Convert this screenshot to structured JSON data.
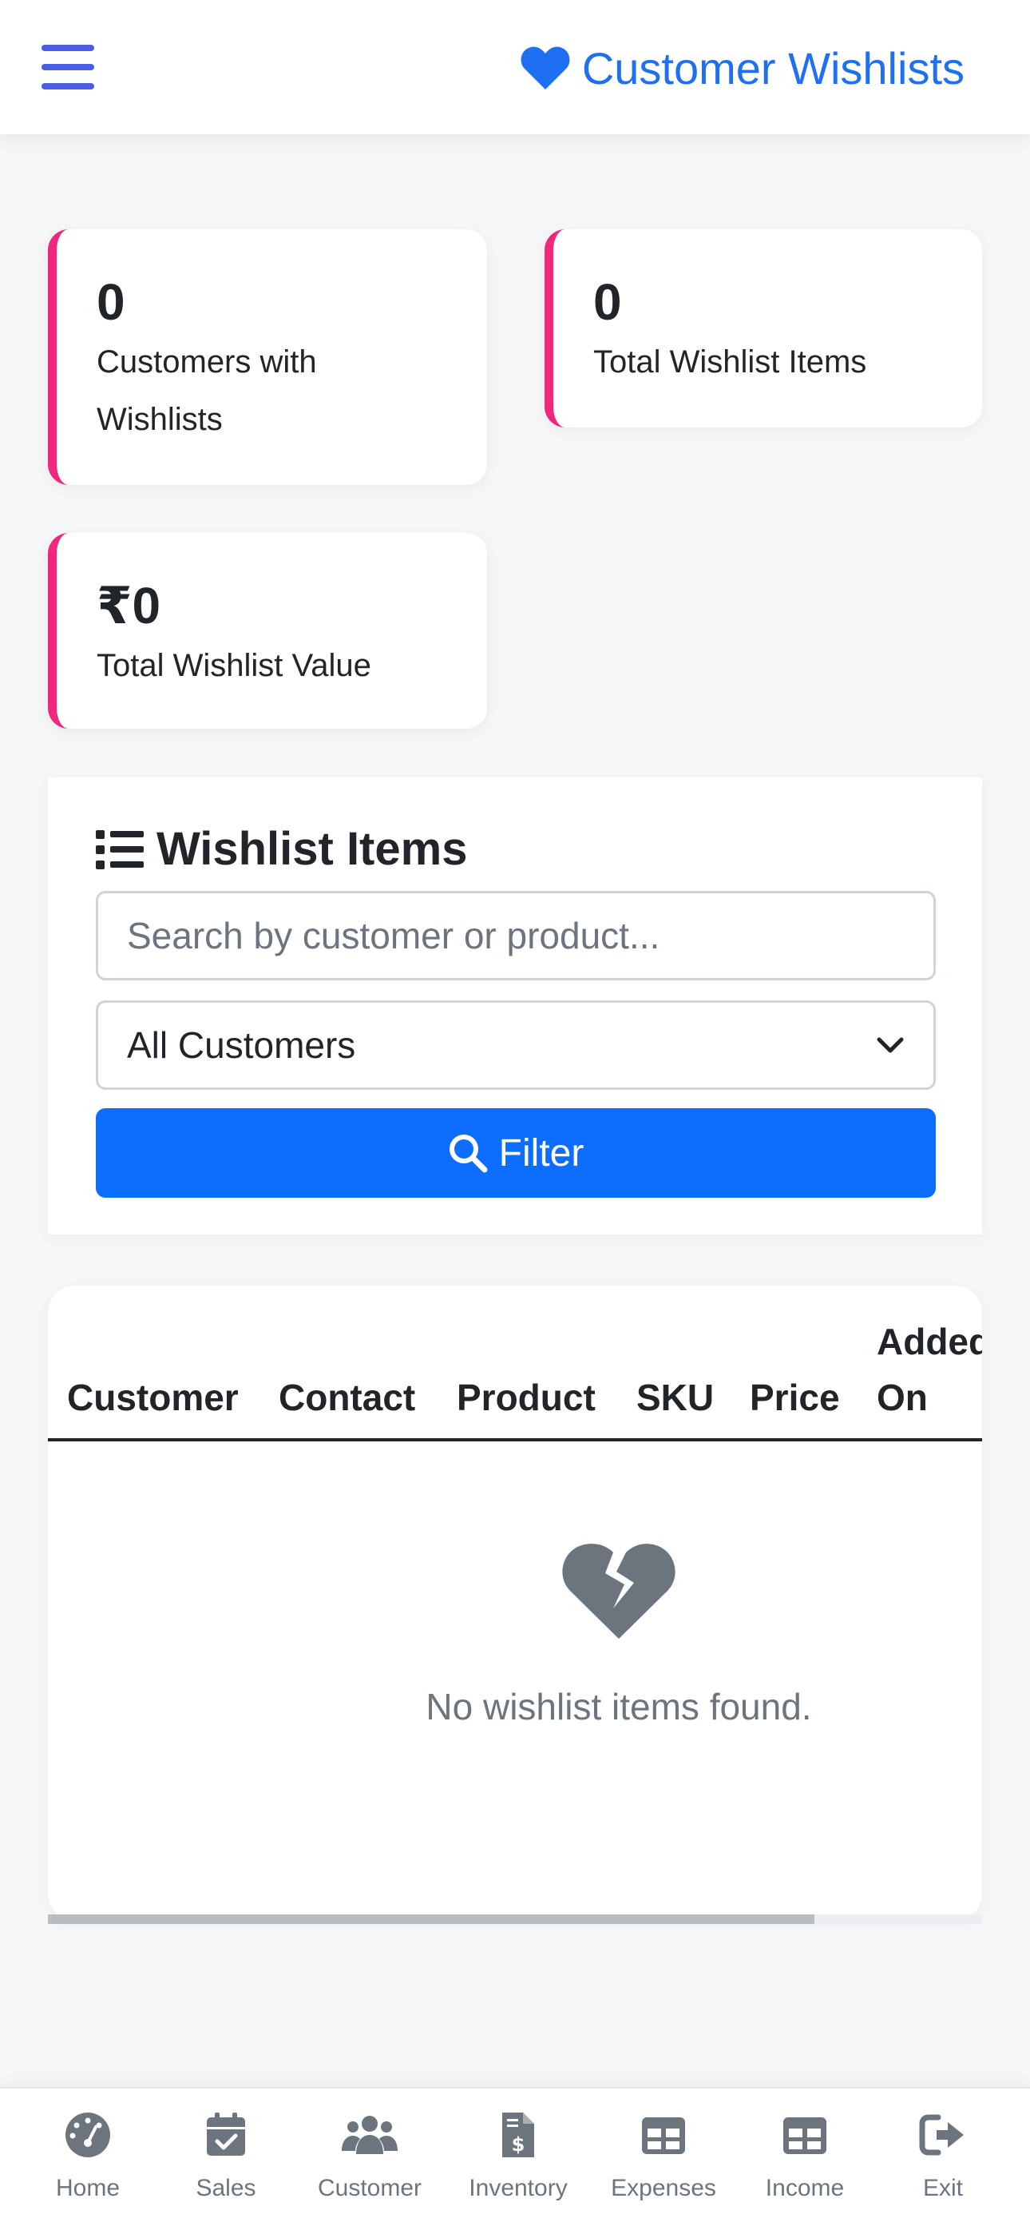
{
  "header": {
    "title": "Customer Wishlists",
    "icon": "heart-icon",
    "accent": "#1e6ff2"
  },
  "stats": [
    {
      "value": "0",
      "label": "Customers with Wishlists"
    },
    {
      "value": "0",
      "label": "Total Wishlist Items"
    },
    {
      "value": "₹0",
      "label": "Total Wishlist Value"
    }
  ],
  "filter_panel": {
    "title": "Wishlist Items",
    "search_placeholder": "Search by customer or product...",
    "customer_select_value": "All Customers",
    "filter_button_label": "Filter"
  },
  "table": {
    "columns": [
      "Customer",
      "Contact",
      "Product",
      "SKU",
      "Price",
      "Added On"
    ],
    "rows": [],
    "empty_message": "No wishlist items found."
  },
  "bottom_nav": [
    {
      "label": "Home",
      "icon": "speedometer-icon"
    },
    {
      "label": "Sales",
      "icon": "calendar-check-icon"
    },
    {
      "label": "Customer",
      "icon": "users-icon"
    },
    {
      "label": "Inventory",
      "icon": "invoice-dollar-icon"
    },
    {
      "label": "Expenses",
      "icon": "table-icon"
    },
    {
      "label": "Income",
      "icon": "table-icon"
    },
    {
      "label": "Exit",
      "icon": "sign-out-icon"
    }
  ],
  "colors": {
    "card_border": "#f0267f",
    "primary_button": "#0d6efd",
    "nav_icon": "#6c757d",
    "muted_text": "#6c757d"
  }
}
